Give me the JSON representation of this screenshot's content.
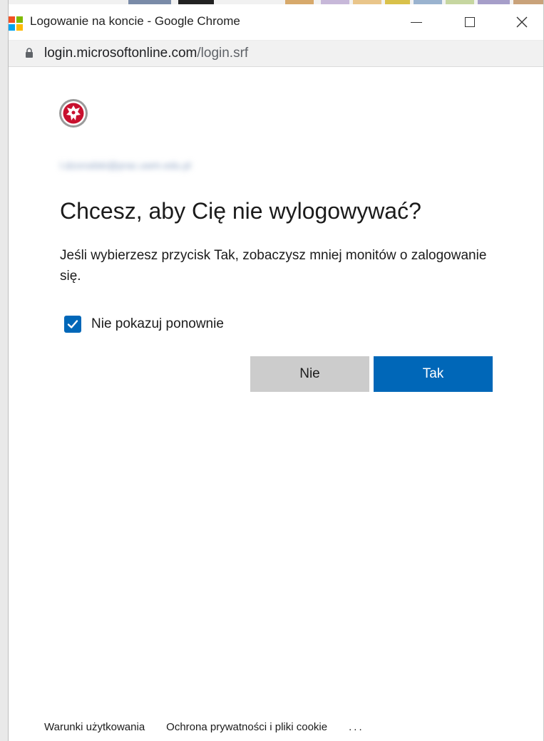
{
  "window": {
    "title": "Logowanie na koncie - Google Chrome",
    "minimize_label": "",
    "maximize_label": "",
    "close_label": "×"
  },
  "address": {
    "host": "login.microsoftonline.com",
    "path": "/login.srf"
  },
  "dialog": {
    "account": "l.dzorodski@prac.uwm.edu.pl",
    "heading": "Chcesz, aby Cię nie wylogowywać?",
    "description": "Jeśli wybierzesz przycisk Tak, zobaczysz mniej monitów o zalogowanie się.",
    "checkbox_label": "Nie pokazuj ponownie",
    "checkbox_checked": true,
    "no_button": "Nie",
    "yes_button": "Tak"
  },
  "footer": {
    "terms": "Warunki użytkowania",
    "privacy": "Ochrona prywatności i pliki cookie",
    "more": "..."
  },
  "colors": {
    "accent": "#0067b8",
    "secondary_button": "#cccccc",
    "text": "#1b1b1b"
  },
  "icons": {
    "app": "microsoft-logo-icon",
    "lock": "lock-icon",
    "checkbox": "checkmark-icon",
    "org": "university-seal-icon"
  }
}
